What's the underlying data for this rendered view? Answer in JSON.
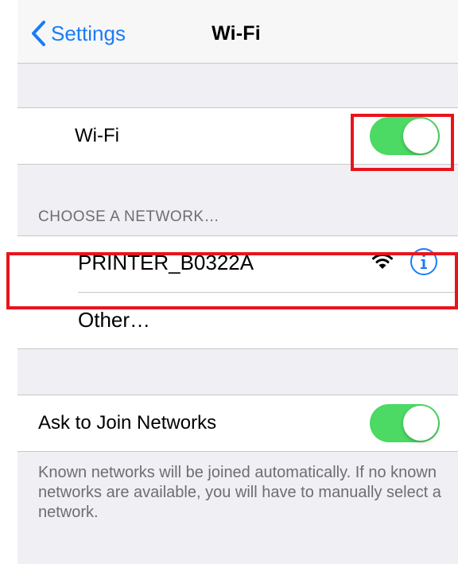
{
  "nav": {
    "back_label": "Settings",
    "title": "Wi-Fi"
  },
  "wifi_row": {
    "label": "Wi-Fi",
    "toggle_on": true
  },
  "networks_section": {
    "header": "CHOOSE A NETWORK…",
    "networks": [
      {
        "name": "PRINTER_B0322A",
        "icon": "wifi-signal-icon",
        "info_icon": "info-icon"
      },
      {
        "name": "Other…"
      }
    ]
  },
  "ask_row": {
    "label": "Ask to Join Networks",
    "toggle_on": true
  },
  "footer_note": "Known networks will be joined automatically. If no known networks are available, you will have to manually select a network.",
  "colors": {
    "accent": "#1a7cf6",
    "toggle_on": "#4cd964",
    "annotation": "#e8141b",
    "background": "#efeff4"
  }
}
